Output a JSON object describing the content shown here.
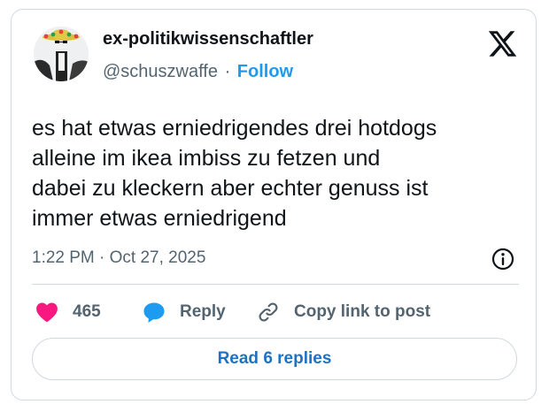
{
  "author": {
    "display_name": "ex-politikwissenschaftler",
    "handle": "@schuszwaffe",
    "separator": "·",
    "follow_label": "Follow"
  },
  "tweet": {
    "text": "es hat etwas erniedrigendes drei hotdogs\nalleine im ikea imbiss zu fetzen und\ndabei zu kleckern aber echter genuss ist\nimmer etwas erniedrigend",
    "timestamp": "1:22 PM · Oct 27, 2025"
  },
  "actions": {
    "like_count": "465",
    "reply_label": "Reply",
    "copy_link_label": "Copy link to post"
  },
  "read_replies_label": "Read 6 replies",
  "icons": {
    "logo": "x-logo-icon",
    "info": "info-icon",
    "like": "heart-icon",
    "reply": "speech-bubble-icon",
    "copy": "link-icon"
  },
  "colors": {
    "accent": "#1d9bf0",
    "like": "#f91880",
    "text": "#0f1419",
    "secondary": "#536471",
    "border": "#cfd9de"
  }
}
